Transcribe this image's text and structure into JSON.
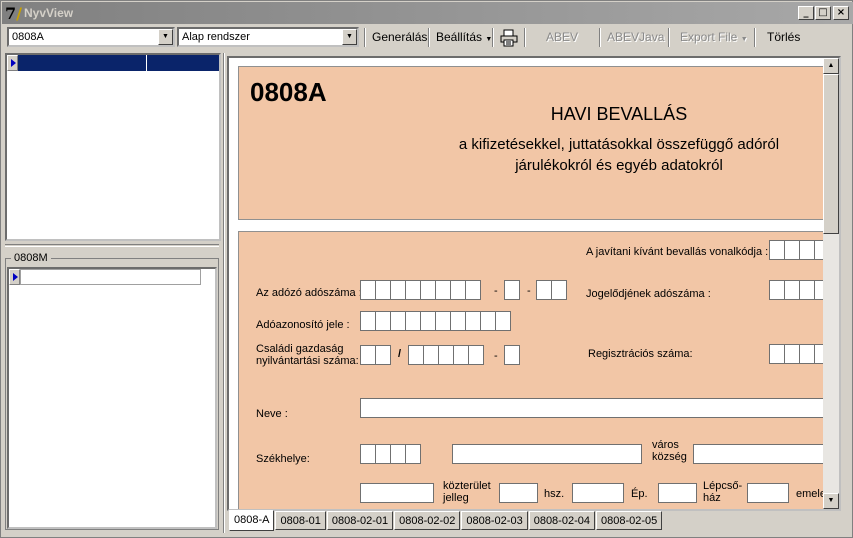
{
  "window": {
    "title": "NyvView"
  },
  "toolbar": {
    "form_combo": "0808A",
    "system_combo": "Alap rendszer",
    "generate": "Generálás",
    "settings": "Beállítás",
    "abev": "ABEV",
    "abevjava": "ABEVJava",
    "export": "Export File",
    "delete": "Törlés"
  },
  "left": {
    "lower_title": "0808M"
  },
  "form": {
    "code": "0808A",
    "title": "HAVI BEVALLÁS",
    "subtitle_line1": "a kifizetésekkel, juttatásokkal összefüggő adóról",
    "subtitle_line2": "járulékokról és egyéb adatokról",
    "correction_barcode": "A javítani kívánt bevallás vonalkódja :",
    "tax_number": "Az adózó adószáma :",
    "predecessor_tax": "Jogelődjének adószáma :",
    "tax_id": "Adóazonosító jele :",
    "household_line1": "Családi gazdaság",
    "household_line2": "nyilvántartási száma:",
    "reg_number": "Regisztrációs száma:",
    "name": "Neve :",
    "seat": "Székhelye:",
    "city_line1": "város",
    "city_line2": "község",
    "street_line1": "közterület",
    "street_line2": "jelleg",
    "hsz": "hsz.",
    "ep": "Ép.",
    "stair_line1": "Lépcső-",
    "stair_line2": "ház",
    "floor": "emelet",
    "dash": "-",
    "slash": "/"
  },
  "tabs": [
    "0808-A",
    "0808-01",
    "0808-02-01",
    "0808-02-02",
    "0808-02-03",
    "0808-02-04",
    "0808-02-05"
  ],
  "colors": {
    "form_bg": "#f2c6a6",
    "selection": "#0a246a"
  }
}
